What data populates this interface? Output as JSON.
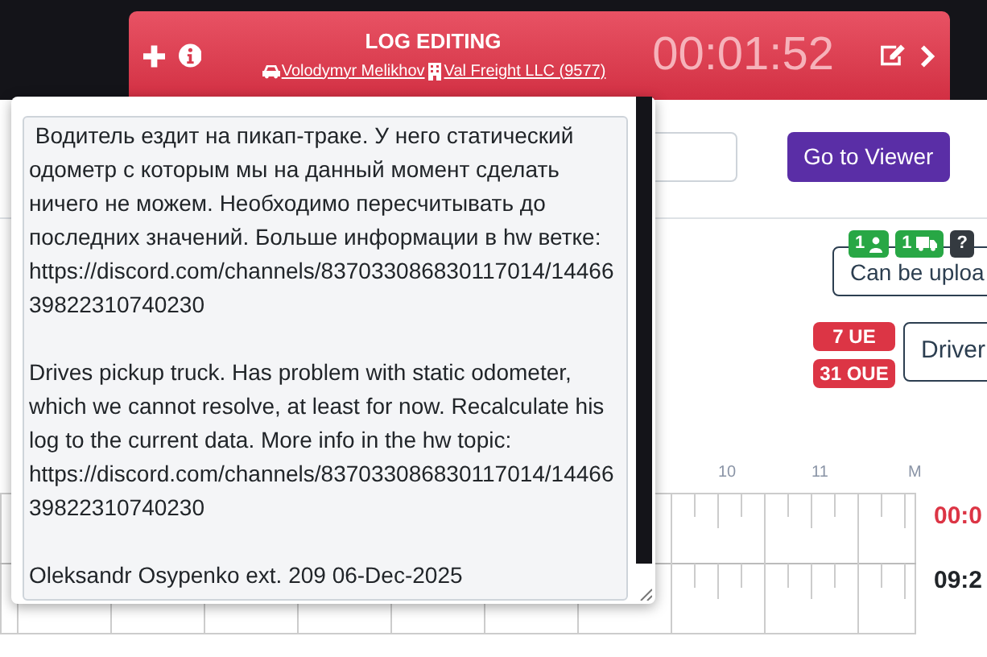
{
  "header": {
    "title": "LOG EDITING",
    "driver": "Volodymyr Melikhov",
    "company": "Val Freight LLC (9577)",
    "timer": "00:01:52"
  },
  "toolbar": {
    "viewer_button": "Go to Viewer"
  },
  "status": {
    "badges": [
      {
        "kind": "driver",
        "label": "1"
      },
      {
        "kind": "vehicle",
        "label": "1"
      },
      {
        "kind": "help",
        "label": "?"
      }
    ],
    "upload_status": "Can be uploa"
  },
  "violations": [
    "7 UE",
    "31 OUE"
  ],
  "driver_button": "Driver",
  "timeline": {
    "hours": [
      "10",
      "11",
      "M"
    ],
    "totals": [
      {
        "label": "00:0",
        "color": "#dc3545"
      },
      {
        "label": "09:2",
        "color": "#212529"
      }
    ]
  },
  "note": {
    "paragraphs": [
      " Водитель ездит на пикап-траке. У него статический одометр с которым мы на данный момент сделать ничего не можем. Необходимо пересчитывать до последних значений. Больше информации в hw ветке: https://discord.com/channels/837033086830117014/1446639822310740230",
      "Drives pickup truck. Has problem with static odometer, which we cannot resolve, at least for now. Recalculate his log to the current data. More info in the hw topic: https://discord.com/channels/837033086830117014/1446639822310740230",
      "Oleksandr Osypenko ext. 209 06-Dec-2025"
    ]
  }
}
